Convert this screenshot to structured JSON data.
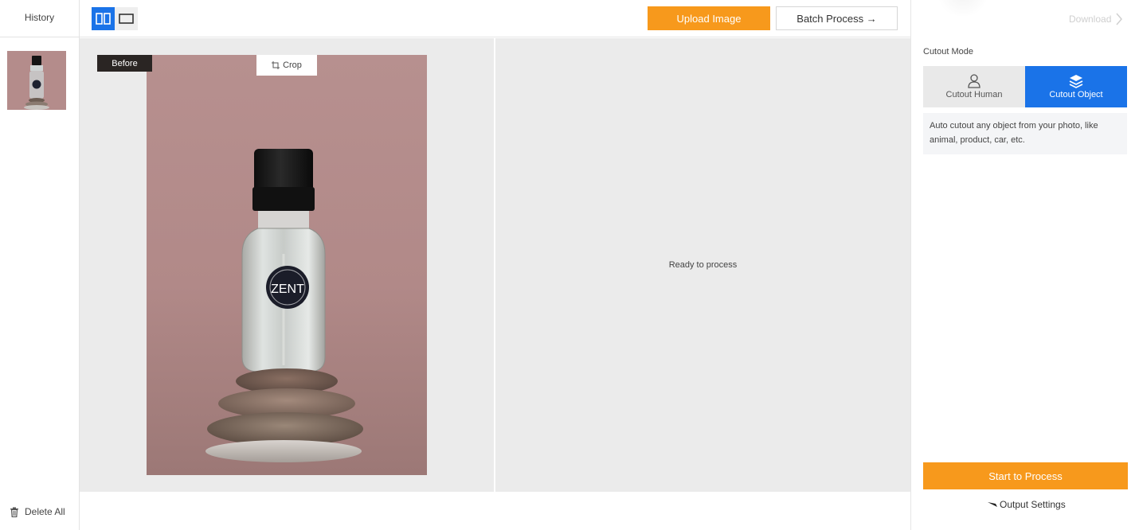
{
  "history": {
    "title": "History",
    "delete_all_label": "Delete All"
  },
  "toolbar": {
    "upload_label": "Upload Image",
    "batch_label": "Batch Process →"
  },
  "preview": {
    "before_label": "Before",
    "crop_label": "Crop",
    "status_text": "Ready to process",
    "bottle_logo": "ZENT"
  },
  "settings": {
    "download_label": "Download",
    "mode_label": "Cutout Mode",
    "modes": [
      {
        "label": "Cutout Human",
        "icon": "person-icon",
        "selected": false
      },
      {
        "label": "Cutout Object",
        "icon": "layers-icon",
        "selected": true
      }
    ],
    "mode_description": "Auto cutout any object from your photo, like animal, product, car, etc.",
    "start_label": "Start to Process",
    "output_settings_label": "Output Settings"
  },
  "colors": {
    "accent_orange": "#f7991c",
    "accent_blue": "#1a73e8",
    "photo_background": "#b48c8b"
  }
}
